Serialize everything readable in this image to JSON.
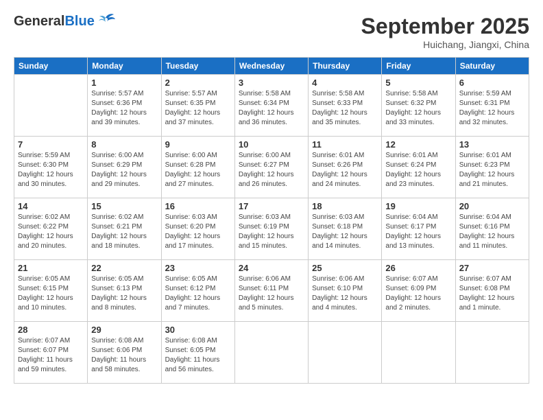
{
  "header": {
    "logo_general": "General",
    "logo_blue": "Blue",
    "month": "September 2025",
    "location": "Huichang, Jiangxi, China"
  },
  "weekdays": [
    "Sunday",
    "Monday",
    "Tuesday",
    "Wednesday",
    "Thursday",
    "Friday",
    "Saturday"
  ],
  "weeks": [
    [
      {
        "day": "",
        "info": ""
      },
      {
        "day": "1",
        "info": "Sunrise: 5:57 AM\nSunset: 6:36 PM\nDaylight: 12 hours\nand 39 minutes."
      },
      {
        "day": "2",
        "info": "Sunrise: 5:57 AM\nSunset: 6:35 PM\nDaylight: 12 hours\nand 37 minutes."
      },
      {
        "day": "3",
        "info": "Sunrise: 5:58 AM\nSunset: 6:34 PM\nDaylight: 12 hours\nand 36 minutes."
      },
      {
        "day": "4",
        "info": "Sunrise: 5:58 AM\nSunset: 6:33 PM\nDaylight: 12 hours\nand 35 minutes."
      },
      {
        "day": "5",
        "info": "Sunrise: 5:58 AM\nSunset: 6:32 PM\nDaylight: 12 hours\nand 33 minutes."
      },
      {
        "day": "6",
        "info": "Sunrise: 5:59 AM\nSunset: 6:31 PM\nDaylight: 12 hours\nand 32 minutes."
      }
    ],
    [
      {
        "day": "7",
        "info": "Sunrise: 5:59 AM\nSunset: 6:30 PM\nDaylight: 12 hours\nand 30 minutes."
      },
      {
        "day": "8",
        "info": "Sunrise: 6:00 AM\nSunset: 6:29 PM\nDaylight: 12 hours\nand 29 minutes."
      },
      {
        "day": "9",
        "info": "Sunrise: 6:00 AM\nSunset: 6:28 PM\nDaylight: 12 hours\nand 27 minutes."
      },
      {
        "day": "10",
        "info": "Sunrise: 6:00 AM\nSunset: 6:27 PM\nDaylight: 12 hours\nand 26 minutes."
      },
      {
        "day": "11",
        "info": "Sunrise: 6:01 AM\nSunset: 6:26 PM\nDaylight: 12 hours\nand 24 minutes."
      },
      {
        "day": "12",
        "info": "Sunrise: 6:01 AM\nSunset: 6:24 PM\nDaylight: 12 hours\nand 23 minutes."
      },
      {
        "day": "13",
        "info": "Sunrise: 6:01 AM\nSunset: 6:23 PM\nDaylight: 12 hours\nand 21 minutes."
      }
    ],
    [
      {
        "day": "14",
        "info": "Sunrise: 6:02 AM\nSunset: 6:22 PM\nDaylight: 12 hours\nand 20 minutes."
      },
      {
        "day": "15",
        "info": "Sunrise: 6:02 AM\nSunset: 6:21 PM\nDaylight: 12 hours\nand 18 minutes."
      },
      {
        "day": "16",
        "info": "Sunrise: 6:03 AM\nSunset: 6:20 PM\nDaylight: 12 hours\nand 17 minutes."
      },
      {
        "day": "17",
        "info": "Sunrise: 6:03 AM\nSunset: 6:19 PM\nDaylight: 12 hours\nand 15 minutes."
      },
      {
        "day": "18",
        "info": "Sunrise: 6:03 AM\nSunset: 6:18 PM\nDaylight: 12 hours\nand 14 minutes."
      },
      {
        "day": "19",
        "info": "Sunrise: 6:04 AM\nSunset: 6:17 PM\nDaylight: 12 hours\nand 13 minutes."
      },
      {
        "day": "20",
        "info": "Sunrise: 6:04 AM\nSunset: 6:16 PM\nDaylight: 12 hours\nand 11 minutes."
      }
    ],
    [
      {
        "day": "21",
        "info": "Sunrise: 6:05 AM\nSunset: 6:15 PM\nDaylight: 12 hours\nand 10 minutes."
      },
      {
        "day": "22",
        "info": "Sunrise: 6:05 AM\nSunset: 6:13 PM\nDaylight: 12 hours\nand 8 minutes."
      },
      {
        "day": "23",
        "info": "Sunrise: 6:05 AM\nSunset: 6:12 PM\nDaylight: 12 hours\nand 7 minutes."
      },
      {
        "day": "24",
        "info": "Sunrise: 6:06 AM\nSunset: 6:11 PM\nDaylight: 12 hours\nand 5 minutes."
      },
      {
        "day": "25",
        "info": "Sunrise: 6:06 AM\nSunset: 6:10 PM\nDaylight: 12 hours\nand 4 minutes."
      },
      {
        "day": "26",
        "info": "Sunrise: 6:07 AM\nSunset: 6:09 PM\nDaylight: 12 hours\nand 2 minutes."
      },
      {
        "day": "27",
        "info": "Sunrise: 6:07 AM\nSunset: 6:08 PM\nDaylight: 12 hours\nand 1 minute."
      }
    ],
    [
      {
        "day": "28",
        "info": "Sunrise: 6:07 AM\nSunset: 6:07 PM\nDaylight: 11 hours\nand 59 minutes."
      },
      {
        "day": "29",
        "info": "Sunrise: 6:08 AM\nSunset: 6:06 PM\nDaylight: 11 hours\nand 58 minutes."
      },
      {
        "day": "30",
        "info": "Sunrise: 6:08 AM\nSunset: 6:05 PM\nDaylight: 11 hours\nand 56 minutes."
      },
      {
        "day": "",
        "info": ""
      },
      {
        "day": "",
        "info": ""
      },
      {
        "day": "",
        "info": ""
      },
      {
        "day": "",
        "info": ""
      }
    ]
  ]
}
